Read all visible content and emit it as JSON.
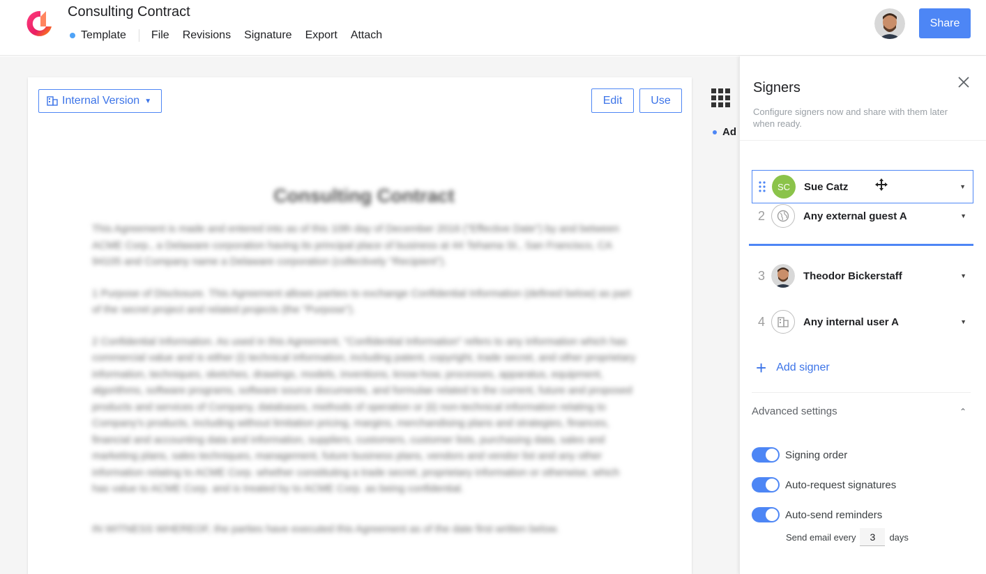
{
  "header": {
    "title": "Consulting Contract",
    "status": "Template",
    "menu": [
      "File",
      "Revisions",
      "Signature",
      "Export",
      "Attach"
    ],
    "share_label": "Share"
  },
  "document": {
    "version_label": "Internal Version",
    "edit_label": "Edit",
    "use_label": "Use",
    "heading": "Consulting Contract",
    "paragraphs": [
      "This Agreement is made and entered into as of this 10th day of December 2016 (\"Effective Date\") by and between ACME Corp., a Delaware corporation having its principal place of business at 44 Tehama St., San Francisco, CA 94105 and Company name a Delaware corporation (collectively \"Recipient\").",
      "1 Purpose of Disclosure. This Agreement allows parties to exchange Confidential Information (defined below) as part of the secret project and related projects (the \"Purpose\").",
      "2 Confidential Information. As used in this Agreement, \"Confidential Information\" refers to any information which has commercial value and is either (i) technical information, including patent, copyright, trade secret, and other proprietary information, techniques, sketches, drawings, models, inventions, know-how, processes, apparatus, equipment, algorithms, software programs, software source documents, and formulae related to the current, future and proposed products and services of Company, databases, methods of operation or (ii) non-technical information relating to Company's products, including without limitation pricing, margins, merchandising plans and strategies, finances, financial and accounting data and information, suppliers, customers, customer lists, purchasing data, sales and marketing plans, sales techniques, management, future business plans, vendors and vendor list and any other information relating to ACME Corp. whether constituting a trade secret, proprietary information or otherwise, which has value to ACME Corp. and is treated by to ACME Corp. as being confidential.",
      "IN WITNESS WHEREOF, the parties have executed this Agreement as of the date first written below."
    ],
    "side_peek_label": "Ad"
  },
  "panel": {
    "title": "Signers",
    "subtitle": "Configure signers now and share with them later when ready.",
    "signers": [
      {
        "num": "",
        "initials": "SC",
        "name": "Sue Catz"
      },
      {
        "num": "2",
        "initials": "",
        "name": "Any external guest A"
      },
      {
        "num": "3",
        "initials": "",
        "name": "Theodor Bickerstaff"
      },
      {
        "num": "4",
        "initials": "",
        "name": "Any internal user A"
      }
    ],
    "add_signer_label": "Add signer",
    "advanced_title": "Advanced settings",
    "toggles": [
      {
        "label": "Signing order",
        "on": true
      },
      {
        "label": "Auto-request signatures",
        "on": true
      },
      {
        "label": "Auto-send reminders",
        "on": true
      }
    ],
    "reminder": {
      "prefix": "Send email every",
      "days": "3",
      "suffix": "days"
    }
  },
  "colors": {
    "accent": "#4d86f5",
    "status_dot": "#4fa3f7",
    "avatar_green": "#8bc34a"
  }
}
